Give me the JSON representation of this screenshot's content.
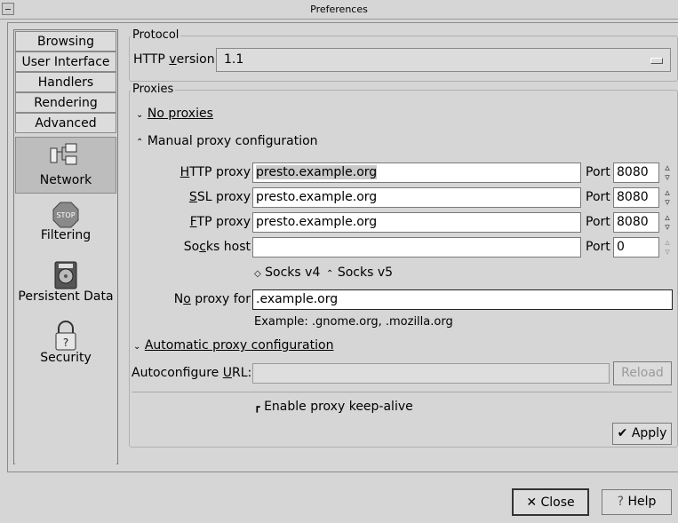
{
  "window": {
    "title": "Preferences"
  },
  "sidebar": {
    "tabs": [
      "Browsing",
      "User Interface",
      "Handlers",
      "Rendering",
      "Advanced"
    ],
    "items": [
      {
        "label": "Network",
        "icon": "network-icon"
      },
      {
        "label": "Filtering",
        "icon": "stop-icon",
        "icon_text": "STOP"
      },
      {
        "label": "Persistent Data",
        "icon": "disk-icon"
      },
      {
        "label": "Security",
        "icon": "lock-icon"
      }
    ]
  },
  "protocol": {
    "legend": "Protocol",
    "http_version_label": "HTTP version",
    "http_version_value": "1.1"
  },
  "proxies": {
    "legend": "Proxies",
    "no_proxies_label": "No proxies",
    "manual_label": "Manual proxy configuration",
    "http_proxy_label": "HTTP proxy",
    "http_proxy_value": "presto.example.org",
    "ssl_proxy_label": "SSL proxy",
    "ssl_proxy_value": "presto.example.org",
    "ftp_proxy_label": "FTP proxy",
    "ftp_proxy_value": "presto.example.org",
    "socks_host_label": "Socks host",
    "socks_host_value": "",
    "port_label": "Port",
    "http_port": "8080",
    "ssl_port": "8080",
    "ftp_port": "8080",
    "socks_port": "0",
    "socks_v4_label": "Socks v4",
    "socks_v5_label": "Socks v5",
    "no_proxy_for_label": "No proxy for",
    "no_proxy_for_value": ".example.org",
    "example_text": "Example: .gnome.org, .mozilla.org",
    "automatic_label": "Automatic proxy configuration",
    "autoconfig_label": "Autoconfigure URL:",
    "autoconfig_value": "",
    "reload_label": "Reload",
    "keepalive_label": "Enable proxy keep-alive",
    "apply_label": "Apply"
  },
  "footer": {
    "close_label": "Close",
    "help_label": "Help"
  }
}
